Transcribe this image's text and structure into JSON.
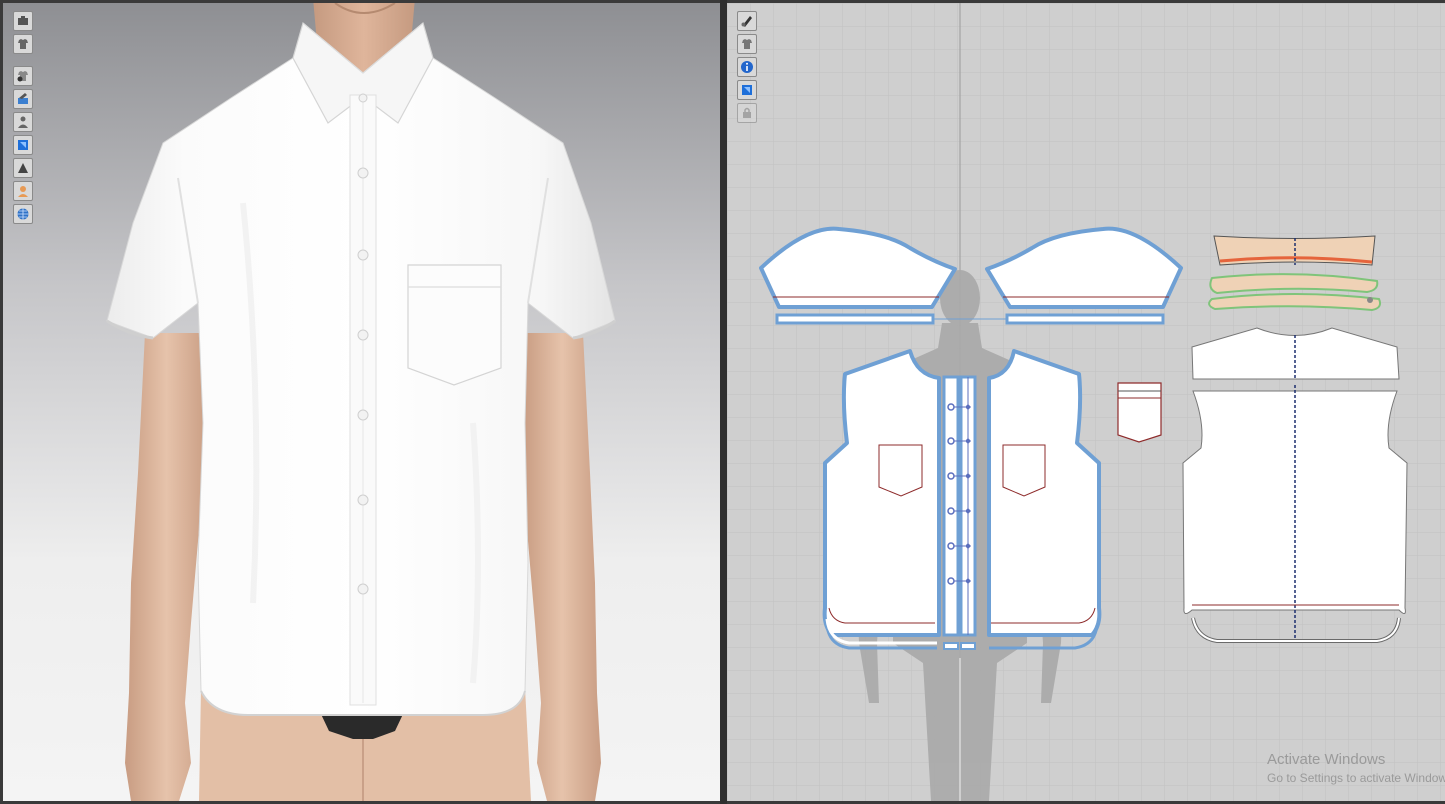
{
  "watermark": {
    "title": "Activate Windows",
    "subtitle": "Go to Settings to activate Windows."
  },
  "toolbar3d": [
    "camera-icon",
    "garment-display-icon",
    "garment-visibility-icon",
    "texture-icon",
    "avatar-visibility-icon",
    "fabric-display-icon",
    "surface-shading-icon",
    "avatar-display-icon",
    "globe-icon"
  ],
  "toolbar2d": [
    "pen-tool-icon",
    "pattern-display-icon",
    "info-icon",
    "fabric-icon",
    "lock-icon"
  ],
  "colors": {
    "seam_blue": "#6fa0d4",
    "band_tan": "#efd2b6",
    "band_orange": "#e5643c",
    "band_green": "#7fc47a",
    "line_red": "#8e2b2b",
    "point_blue": "#5b6fbe"
  }
}
